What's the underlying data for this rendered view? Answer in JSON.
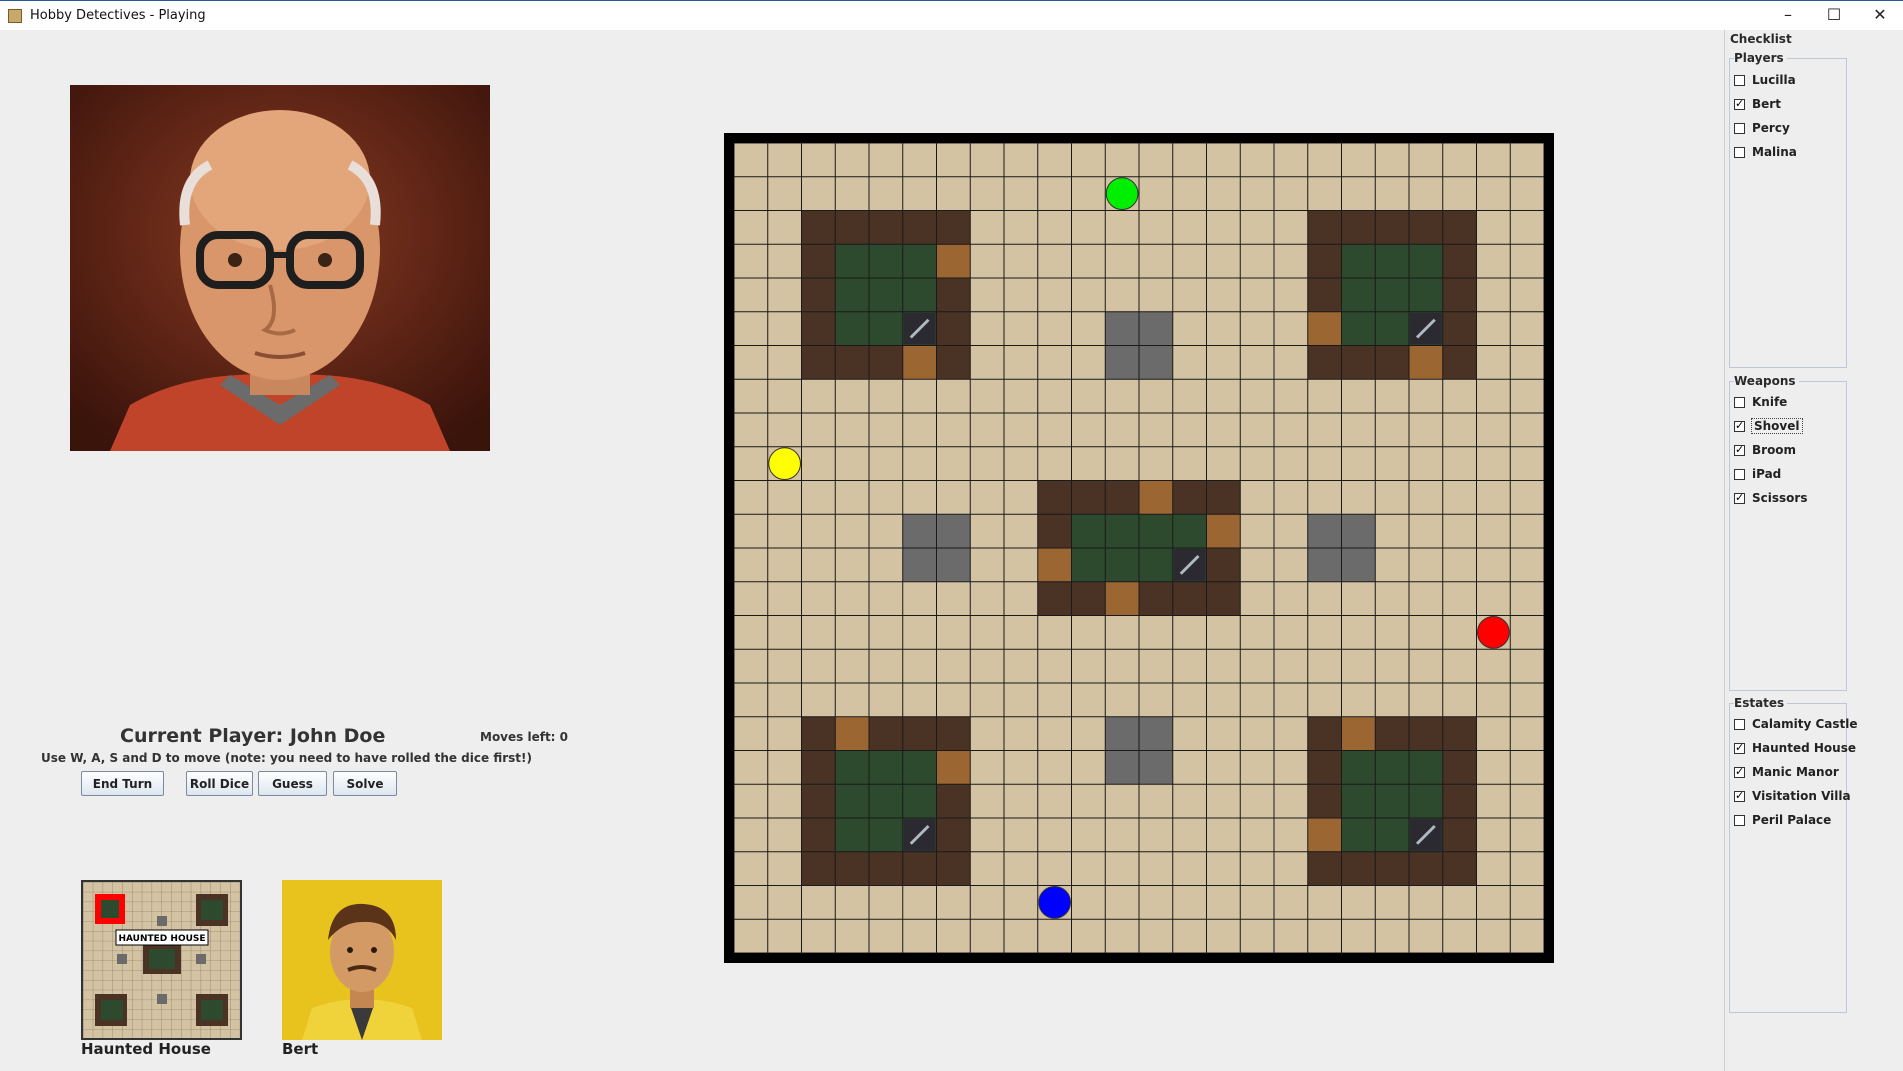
{
  "window": {
    "title": "Hobby Detectives - Playing",
    "minimize_icon": "minimize-icon",
    "maximize_icon": "maximize-icon",
    "close_icon": "close-icon"
  },
  "status": {
    "current_player": "Current Player: John Doe",
    "moves_left": "Moves left: 0",
    "instructions": "Use W, A, S and D to move (note: you need to have rolled the dice first!)"
  },
  "buttons": {
    "end_turn": "End Turn",
    "roll_dice": "Roll Dice",
    "guess": "Guess",
    "solve": "Solve"
  },
  "cards": {
    "estate": {
      "name": "Haunted House",
      "map_label": "HAUNTED HOUSE"
    },
    "character": {
      "name": "Bert"
    }
  },
  "checklist": {
    "title": "Checklist",
    "players": {
      "title": "Players",
      "items": [
        {
          "label": "Lucilla",
          "checked": false
        },
        {
          "label": "Bert",
          "checked": true
        },
        {
          "label": "Percy",
          "checked": false
        },
        {
          "label": "Malina",
          "checked": false
        }
      ]
    },
    "weapons": {
      "title": "Weapons",
      "items": [
        {
          "label": "Knife",
          "checked": false
        },
        {
          "label": "Shovel",
          "checked": true
        },
        {
          "label": "Broom",
          "checked": true
        },
        {
          "label": "iPad",
          "checked": false
        },
        {
          "label": "Scissors",
          "checked": true
        }
      ]
    },
    "estates": {
      "title": "Estates",
      "items": [
        {
          "label": "Calamity Castle",
          "checked": false
        },
        {
          "label": "Haunted House",
          "checked": true
        },
        {
          "label": "Manic Manor",
          "checked": true
        },
        {
          "label": "Visitation Villa",
          "checked": true
        },
        {
          "label": "Peril Palace",
          "checked": false
        }
      ]
    }
  },
  "colors": {
    "floor": "#d3c3a3",
    "estate_wall": "#4a3325",
    "estate_floor": "#2e4a2e",
    "door": "#9c6632",
    "obstacle": "#6b6b6b",
    "player_green": "#00ee00",
    "player_yellow": "#ffff00",
    "player_red": "#ff0000",
    "player_blue": "#0000ff"
  }
}
